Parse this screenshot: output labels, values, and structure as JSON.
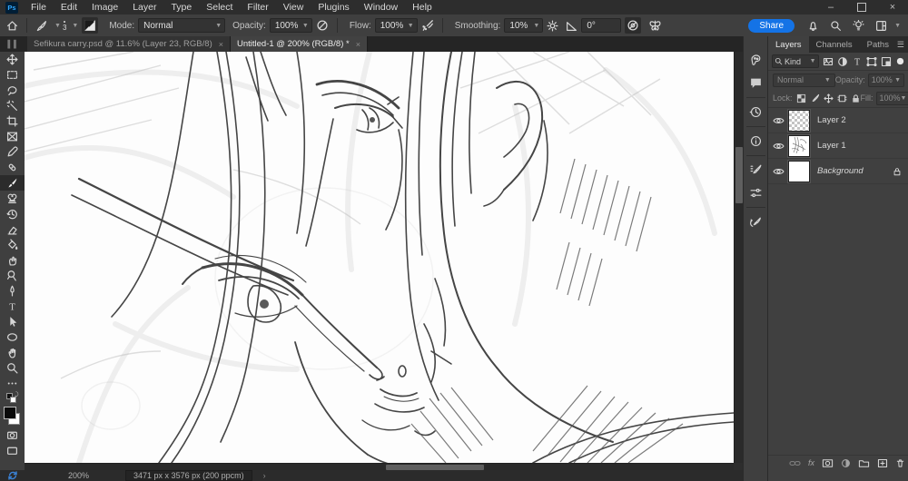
{
  "menubar": {
    "logo": "Ps",
    "items": [
      "File",
      "Edit",
      "Image",
      "Layer",
      "Type",
      "Select",
      "Filter",
      "View",
      "Plugins",
      "Window",
      "Help"
    ]
  },
  "window_controls": {
    "minimize": "–",
    "close": "×"
  },
  "options": {
    "brush_size": "3",
    "mode_label": "Mode:",
    "mode_value": "Normal",
    "opacity_label": "Opacity:",
    "opacity_value": "100%",
    "flow_label": "Flow:",
    "flow_value": "100%",
    "smoothing_label": "Smoothing:",
    "smoothing_value": "10%",
    "angle_value": "0°",
    "share": "Share"
  },
  "tabs": {
    "doc1": "Sefikura carry.psd @ 11.6% (Layer 23, RGB/8)",
    "doc2": "Untitled-1 @ 200% (RGB/8) *",
    "close": "×"
  },
  "panel": {
    "tabs": {
      "layers": "Layers",
      "channels": "Channels",
      "paths": "Paths"
    },
    "kind": "Kind",
    "blend_mode": "Normal",
    "opacity_label": "Opacity:",
    "opacity_value": "100%",
    "lock_label": "Lock:",
    "fill_label": "Fill:",
    "fill_value": "100%",
    "layers": [
      {
        "name": "Layer 2"
      },
      {
        "name": "Layer 1"
      },
      {
        "name": "Background"
      }
    ],
    "fx": "fx"
  },
  "status": {
    "zoom": "200%",
    "doc_info": "3471 px x 3576 px (200 ppcm)"
  },
  "colors": {
    "accent_blue": "#1473e6",
    "ps_logo_blue": "#31a8ff",
    "canvas_bg": "#fdfdfd"
  }
}
